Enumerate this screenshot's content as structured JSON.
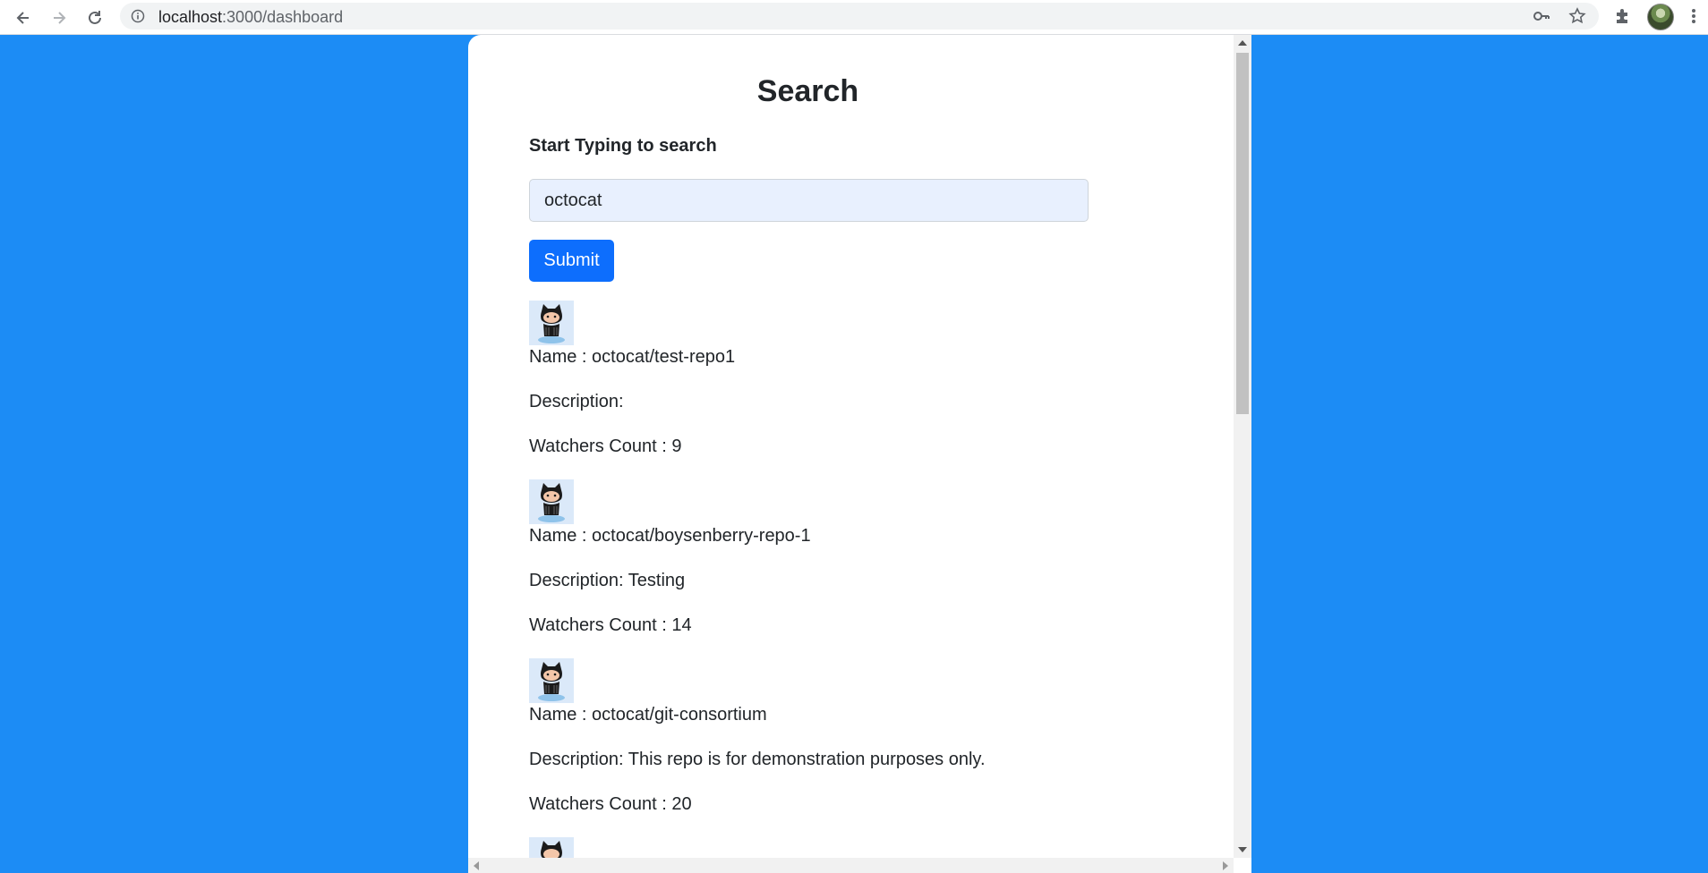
{
  "browser": {
    "url_host": "localhost",
    "url_path": ":3000/dashboard"
  },
  "page": {
    "title": "Search",
    "label": "Start Typing to search",
    "search_value": "octocat",
    "submit_label": "Submit"
  },
  "repos": [
    {
      "name": "Name : octocat/test-repo1",
      "description": "Description:",
      "watchers": "Watchers Count : 9"
    },
    {
      "name": "Name : octocat/boysenberry-repo-1",
      "description": "Description: Testing",
      "watchers": "Watchers Count : 14"
    },
    {
      "name": "Name : octocat/git-consortium",
      "description": "Description: This repo is for demonstration purposes only.",
      "watchers": "Watchers Count : 20"
    }
  ],
  "colors": {
    "background": "#1c8cf5",
    "button": "#0d6efd",
    "input_bg": "#e8f0fe"
  }
}
